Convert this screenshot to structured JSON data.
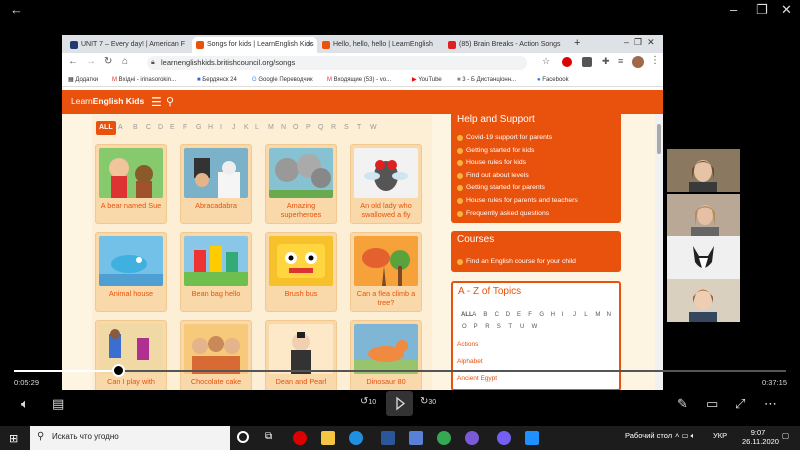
{
  "player": {
    "elapsed": "0:05:29",
    "total": "0:37:15",
    "progress_fraction": 0.135,
    "skip_back": "10",
    "skip_fwd": "30"
  },
  "browser": {
    "tabs": [
      {
        "label": "UNIT 7 – Every day! | American F",
        "color": "#1e3a6e"
      },
      {
        "label": "Songs for kids | LearnEnglish Kids",
        "color": "#e8520d"
      },
      {
        "label": "Hello, hello, hello | LearnEnglish",
        "color": "#e8520d"
      },
      {
        "label": "(85) Brain Breaks - Action Songs",
        "color": "#e02020"
      }
    ],
    "url": "learnenglishkids.britishcouncil.org/songs",
    "bookmarks": [
      "Додатки",
      "Вхідні - irinasorokin...",
      "Бердянск 24",
      "Google Переводчик",
      "Входящие (53) - vo...",
      "YouTube",
      "3 - Б Дистанціонн...",
      "Facebook"
    ]
  },
  "site": {
    "logo_prefix": "Learn",
    "logo_main": "English Kids",
    "alphabet": [
      "ALL",
      "A",
      "B",
      "C",
      "D",
      "E",
      "F",
      "G",
      "H",
      "I",
      "J",
      "K",
      "L",
      "M",
      "N",
      "O",
      "P",
      "Q",
      "R",
      "S",
      "T",
      "W"
    ],
    "songs": [
      {
        "title": "A bear named Sue"
      },
      {
        "title": "Abracadabra"
      },
      {
        "title": "Amazing superheroes"
      },
      {
        "title": "An old lady who swallowed a fly"
      },
      {
        "title": "Animal house"
      },
      {
        "title": "Bean bag hello"
      },
      {
        "title": "Brush bus"
      },
      {
        "title": "Can a flea climb a tree?"
      },
      {
        "title": "Can I play with"
      },
      {
        "title": "Chocolate cake"
      },
      {
        "title": "Dean and Pearl"
      },
      {
        "title": "Dinosaur 80"
      }
    ],
    "help": {
      "title": "Help and Support",
      "links": [
        "Covid-19 support for parents",
        "Getting started for kids",
        "House rules for kids",
        "Find out about levels",
        "Getting started for parents",
        "House rules for parents and teachers",
        "Frequently asked questions"
      ]
    },
    "courses": {
      "title": "Courses",
      "links": [
        "Find an English course for your child"
      ]
    },
    "topics": {
      "title": "A - Z of Topics",
      "letters_row1": [
        "ALL",
        "A",
        "B",
        "C",
        "D",
        "E",
        "F",
        "G",
        "H",
        "I",
        "J",
        "L",
        "M",
        "N"
      ],
      "letters_row2": [
        "O",
        "P",
        "R",
        "S",
        "T",
        "U",
        "W"
      ],
      "links": [
        "Actions",
        "Alphabet",
        "Ancient Egypt"
      ]
    }
  },
  "taskbar": {
    "search_placeholder": "Искать что угодно",
    "desktop_label": "Рабочий стол",
    "lang": "УКР",
    "time": "9:07",
    "date": "26.11.2020"
  }
}
